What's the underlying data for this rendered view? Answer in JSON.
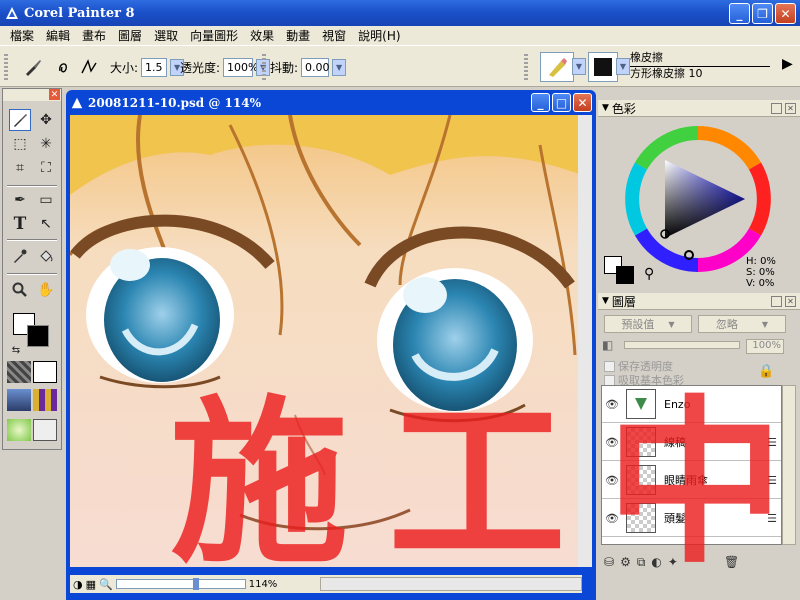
{
  "app": {
    "title": "Corel Painter 8"
  },
  "menu": [
    "檔案",
    "編輯",
    "畫布",
    "圖層",
    "選取",
    "向量圖形",
    "效果",
    "動畫",
    "視窗",
    "說明(H)"
  ],
  "propbar": {
    "size_label": "大小:",
    "size_value": "1.5",
    "opacity_label": "透光度:",
    "opacity_value": "100%",
    "jitter_label": "抖動:",
    "jitter_value": "0.00",
    "brush_category": "橡皮擦",
    "brush_variant": "方形橡皮擦 10"
  },
  "document": {
    "title": "20081211-10.psd @ 114%",
    "zoom": "114%"
  },
  "color_panel": {
    "title": "色彩",
    "h": "H: 0%",
    "s": "S: 0%",
    "v": "V: 0%"
  },
  "layers_panel": {
    "title": "圖層",
    "composite_method": "預設值",
    "ignore_label": "忽略",
    "opacity": "100%",
    "preserve_transparency": "保存透明度",
    "pick_underlying_color": "吸取基本色彩",
    "items": [
      {
        "name": "Enzo"
      },
      {
        "name": "線稿"
      },
      {
        "name": "眼睛雨傘"
      },
      {
        "name": "頭髮"
      }
    ]
  },
  "overlay": {
    "text": "施工中"
  },
  "colors": {
    "titlebar": "#1a4fc8",
    "overlay": "#ec1e1e",
    "eye": "#2a7fa8"
  }
}
